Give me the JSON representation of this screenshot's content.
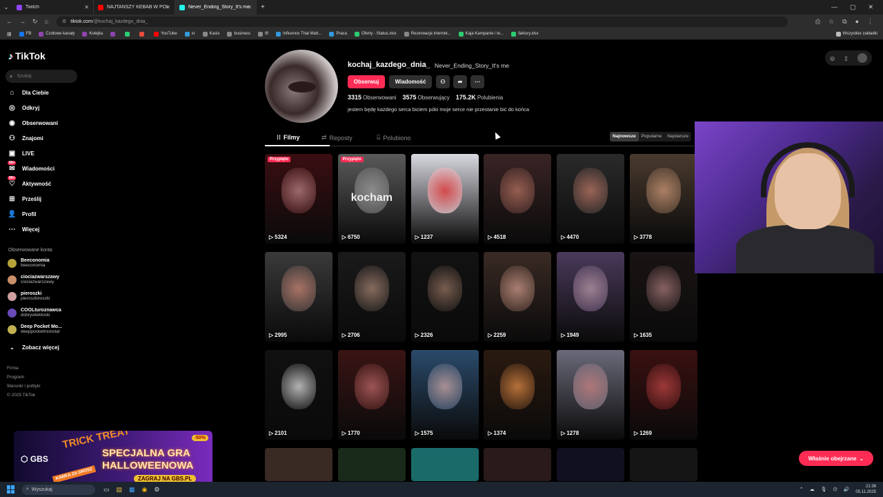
{
  "browser": {
    "tabs": [
      {
        "label": "Twitch",
        "color": "#9146ff",
        "active": false
      },
      {
        "label": "NAJTAŃSZY KEBAB W POLSCE!",
        "color": "#ff0000",
        "active": false
      },
      {
        "label": "Never_Ending_Story_It's me (@",
        "color": "#25f4ee",
        "active": true
      }
    ],
    "new_tab": "+",
    "url_host": "tiktok.com",
    "url_path": "/@kochaj_kazdego_dnia_",
    "bookmarks": [
      {
        "label": "FB",
        "color": "#1877f2"
      },
      {
        "label": "Czołowe kanały",
        "color": "#8e44ad"
      },
      {
        "label": "Kolejka",
        "color": "#8e44ad"
      },
      {
        "label": "",
        "color": "#8e44ad"
      },
      {
        "label": "",
        "color": "#2ecc71"
      },
      {
        "label": "",
        "color": "#e74c3c"
      },
      {
        "label": "YouTube",
        "color": "#ff0000"
      },
      {
        "label": "sr",
        "color": "#3498db"
      },
      {
        "label": "Kasix",
        "color": "#888888"
      },
      {
        "label": "business",
        "color": "#888888"
      },
      {
        "label": "tft",
        "color": "#888888"
      },
      {
        "label": "Influence That Matt...",
        "color": "#3498db"
      },
      {
        "label": "Praca",
        "color": "#3498db"
      },
      {
        "label": "Oferty - Status.xlsx",
        "color": "#2ecc71"
      },
      {
        "label": "Rezerwacje internet...",
        "color": "#888888"
      },
      {
        "label": "Kaja Kampanie i te...",
        "color": "#2ecc71"
      },
      {
        "label": "faktury.xlsx",
        "color": "#2ecc71"
      }
    ],
    "all_bookmarks": "Wszystkie zakładki"
  },
  "sidebar": {
    "logo": "TikTok",
    "search_placeholder": "Szukaj",
    "nav": [
      {
        "label": "Dla Ciebie",
        "icon": "home-icon",
        "glyph": "⌂"
      },
      {
        "label": "Odkryj",
        "icon": "compass-icon",
        "glyph": "◎"
      },
      {
        "label": "Obserwowani",
        "icon": "following-icon",
        "glyph": "◉"
      },
      {
        "label": "Znajomi",
        "icon": "friends-icon",
        "glyph": "⚇"
      },
      {
        "label": "LIVE",
        "icon": "live-icon",
        "glyph": "▣"
      },
      {
        "label": "Wiadomości",
        "icon": "messages-icon",
        "glyph": "✉",
        "badge": "99+"
      },
      {
        "label": "Aktywność",
        "icon": "activity-icon",
        "glyph": "♡",
        "badge": "99+"
      },
      {
        "label": "Prześlij",
        "icon": "upload-icon",
        "glyph": "⊞"
      },
      {
        "label": "Profil",
        "icon": "profile-icon",
        "glyph": "👤"
      },
      {
        "label": "Więcej",
        "icon": "more-icon",
        "glyph": "⋯"
      }
    ],
    "followed_title": "Obserwowane konta",
    "accounts": [
      {
        "name": "Beeconomia",
        "handle": "beeconomia",
        "color": "#b8a33a"
      },
      {
        "name": "ciociazwarszawy",
        "handle": "ciociazwarszawy",
        "color": "#c98f6a"
      },
      {
        "name": "pieroszki",
        "handle": "pieroszkiroszki",
        "color": "#d0a0a0"
      },
      {
        "name": "COOLturoznawca",
        "handle": "dobrywteklocki",
        "color": "#6a4ab8"
      },
      {
        "name": "Deep Pocket Mo...",
        "handle": "deeppocketmonstar",
        "color": "#c0b050"
      }
    ],
    "see_more": "Zobacz więcej",
    "footer": [
      "Firma",
      "Program",
      "Warunki i polityki",
      "© 2025 TikTok"
    ]
  },
  "ad": {
    "brand": "GBS",
    "trick": "TRICK TREAT",
    "headline_1": "SPECJALNA GRA",
    "headline_2": "HALLOWEENOWA",
    "cta": "ZAGRAJ NA GBS.PL",
    "discount": "-50%",
    "kawa": "KAWKA ZA GROSZ"
  },
  "profile": {
    "username": "kochaj_kazdego_dnia_",
    "nickname": "Never_Ending_Story_It's me",
    "follow_label": "Obserwuj",
    "message_label": "Wiadomość",
    "following_count": "3315",
    "following_label": "Obserwowani",
    "followers_count": "3575",
    "followers_label": "Obserwujący",
    "likes_count": "175.2K",
    "likes_label": "Polubienia",
    "bio": "jestem będę każdego serca biciem póki moje serce nie przestanie bić do końca",
    "tabs": [
      "Filmy",
      "Reposty",
      "Polubiono"
    ],
    "sort": [
      "Najnowsze",
      "Popularne",
      "Najstarsze"
    ]
  },
  "videos": [
    {
      "views": "5324",
      "pinned": "Przypięto",
      "bg": "#3a0e12",
      "face": "#b07a7a"
    },
    {
      "views": "6750",
      "pinned": "Przypięto",
      "bg": "#5a5a5a",
      "face": "#9a9a9a",
      "overlay": "kocham"
    },
    {
      "views": "1237",
      "bg": "#d8d8e0",
      "face": "#e04040"
    },
    {
      "views": "4518",
      "bg": "#3a2424",
      "face": "#a86a5a"
    },
    {
      "views": "4470",
      "bg": "#2a2a2a",
      "face": "#b07060"
    },
    {
      "views": "3778",
      "bg": "#4a3a2e",
      "face": "#c09070"
    },
    {
      "views": "2995",
      "bg": "#3a3a3a",
      "face": "#c08070"
    },
    {
      "views": "2706",
      "bg": "#1a1a1a",
      "face": "#9a7a6a"
    },
    {
      "views": "2326",
      "bg": "#121212",
      "face": "#8a6a5a"
    },
    {
      "views": "2259",
      "bg": "#3a2a24",
      "face": "#c09080"
    },
    {
      "views": "1949",
      "bg": "#4a3a5a",
      "face": "#b090a0"
    },
    {
      "views": "1635",
      "bg": "#1a1414",
      "face": "#9a7070"
    },
    {
      "views": "2101",
      "bg": "#101010",
      "face": "#cfcfcf"
    },
    {
      "views": "1770",
      "bg": "#3a1414",
      "face": "#b06060"
    },
    {
      "views": "1575",
      "bg": "#2a4a6a",
      "face": "#c0a0a0"
    },
    {
      "views": "1374",
      "bg": "#2a1a10",
      "face": "#d08040"
    },
    {
      "views": "1278",
      "bg": "#6a6a7a",
      "face": "#c08080"
    },
    {
      "views": "1269",
      "bg": "#3a1010",
      "face": "#b04040"
    }
  ],
  "watched_label": "Właśnie obejrzane",
  "taskbar": {
    "search": "Wyszukaj",
    "time": "21:36",
    "date": "05.11.2025"
  }
}
